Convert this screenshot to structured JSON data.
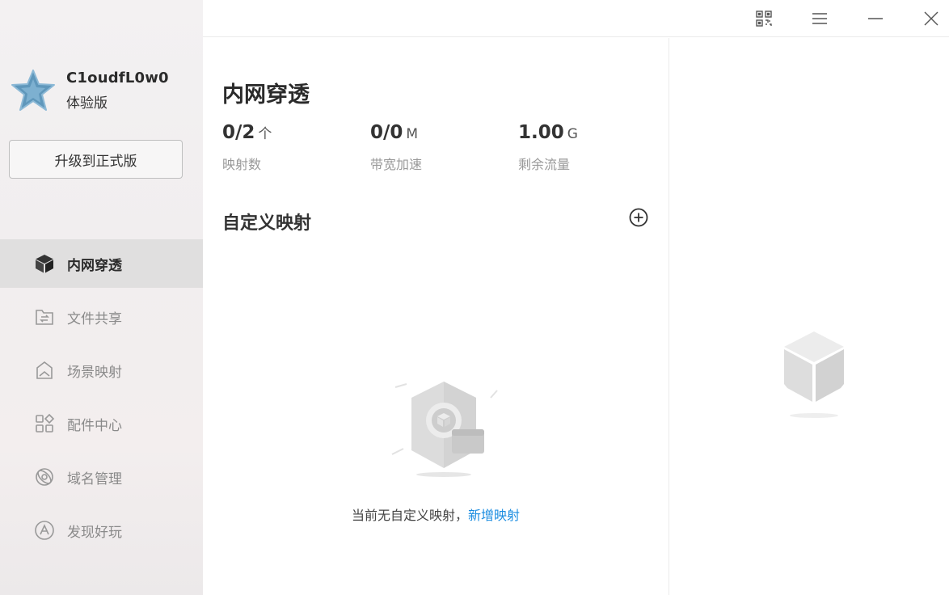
{
  "sidebar": {
    "username": "C1oudfL0w0",
    "edition": "体验版",
    "upgrade_label": "升级到正式版",
    "items": [
      {
        "label": "内网穿透",
        "icon": "cube-icon"
      },
      {
        "label": "文件共享",
        "icon": "folder-share-icon"
      },
      {
        "label": "场景映射",
        "icon": "scene-map-icon"
      },
      {
        "label": "配件中心",
        "icon": "grid-apps-icon"
      },
      {
        "label": "域名管理",
        "icon": "domain-icon"
      },
      {
        "label": "发现好玩",
        "icon": "discover-icon"
      }
    ]
  },
  "titlebar": {
    "icons": [
      "qrcode-icon",
      "menu-icon",
      "minimize-icon",
      "close-icon"
    ]
  },
  "main": {
    "title": "内网穿透",
    "stats": [
      {
        "value": "0/2",
        "unit": "个",
        "label": "映射数"
      },
      {
        "value": "0/0",
        "unit": "M",
        "label": "带宽加速"
      },
      {
        "value": "1.00",
        "unit": "G",
        "label": "剩余流量"
      }
    ],
    "section_title": "自定义映射",
    "empty_text": "当前无自定义映射，",
    "empty_link": "新增映射"
  },
  "colors": {
    "accent": "#1a8ce0",
    "avatar_star": "#6fa3c4",
    "active_nav_bg": "#e0dfdf"
  }
}
